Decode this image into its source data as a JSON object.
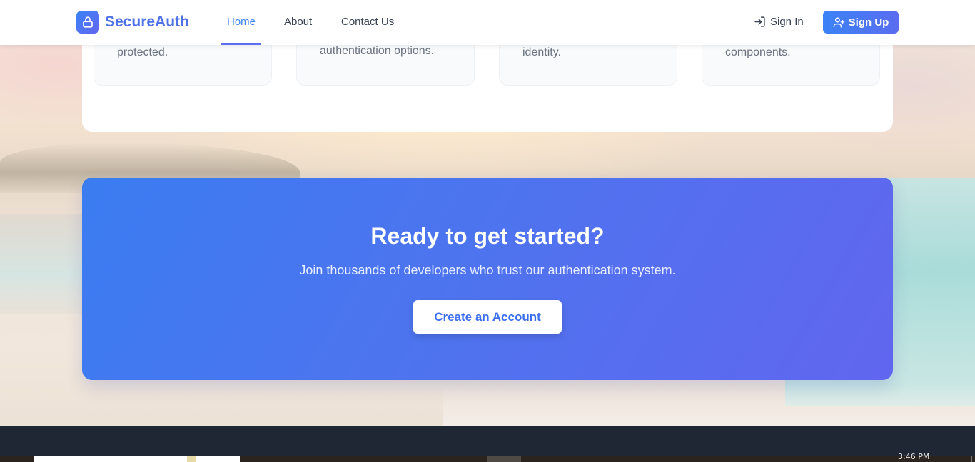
{
  "brand": {
    "name": "SecureAuth",
    "logo_icon": "lock-icon"
  },
  "nav": {
    "links": [
      {
        "label": "Home",
        "active": true
      },
      {
        "label": "About",
        "active": false
      },
      {
        "label": "Contact Us",
        "active": false
      }
    ],
    "signin_label": "Sign In",
    "signup_label": "Sign Up"
  },
  "features": {
    "cards": [
      {
        "text": "protected."
      },
      {
        "text": "authentication options."
      },
      {
        "text": "identity."
      },
      {
        "text": "components."
      }
    ]
  },
  "cta": {
    "title": "Ready to get started?",
    "subtitle": "Join thousands of developers who trust our authentication system.",
    "button_label": "Create an Account"
  },
  "taskbar": {
    "clock": "3:46 PM"
  },
  "colors": {
    "accent": "#3b82f6",
    "brand": "#4f72e8",
    "cta_gradient_start": "#3b7cf1",
    "cta_gradient_end": "#6166ef",
    "footer": "#1f2735"
  }
}
